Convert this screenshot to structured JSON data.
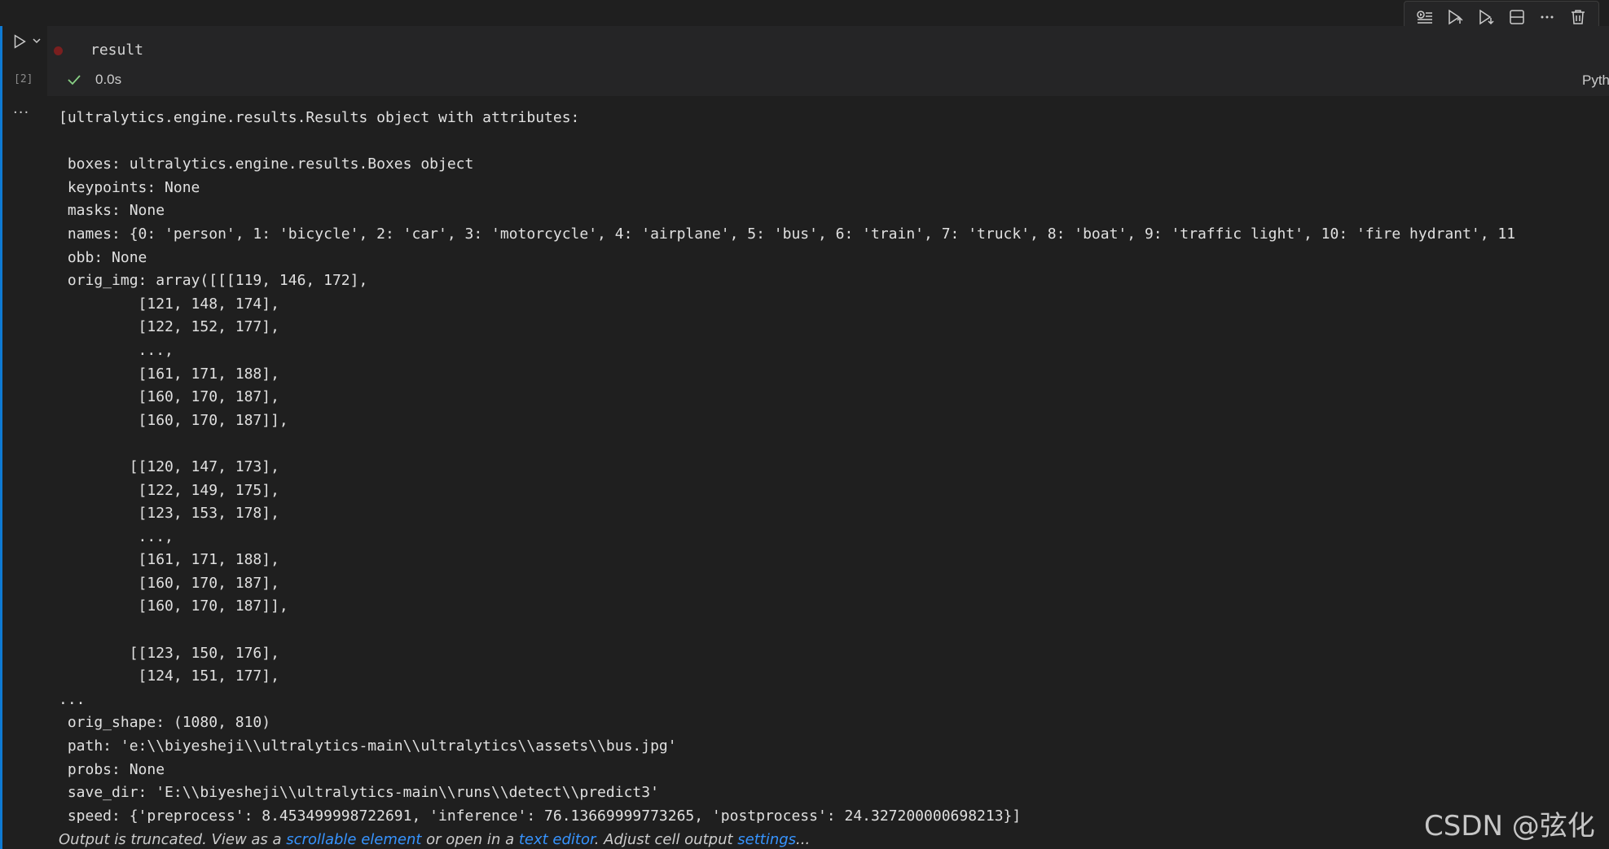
{
  "cell": {
    "code": "result",
    "exec_count": "[2]",
    "status_time": "0.0s",
    "language": "Python"
  },
  "toolbar": {
    "icons": [
      "run-by-line-icon",
      "execute-above-icon",
      "execute-below-icon",
      "split-cell-icon",
      "more-icon",
      "delete-icon"
    ]
  },
  "output": {
    "more_label": "···",
    "lines": [
      "[ultralytics.engine.results.Results object with attributes:",
      "",
      " boxes: ultralytics.engine.results.Boxes object",
      " keypoints: None",
      " masks: None",
      " names: {0: 'person', 1: 'bicycle', 2: 'car', 3: 'motorcycle', 4: 'airplane', 5: 'bus', 6: 'train', 7: 'truck', 8: 'boat', 9: 'traffic light', 10: 'fire hydrant', 11",
      " obb: None",
      " orig_img: array([[[119, 146, 172],",
      "         [121, 148, 174],",
      "         [122, 152, 177],",
      "         ...,",
      "         [161, 171, 188],",
      "         [160, 170, 187],",
      "         [160, 170, 187]],",
      "",
      "        [[120, 147, 173],",
      "         [122, 149, 175],",
      "         [123, 153, 178],",
      "         ...,",
      "         [161, 171, 188],",
      "         [160, 170, 187],",
      "         [160, 170, 187]],",
      "",
      "        [[123, 150, 176],",
      "         [124, 151, 177],",
      "...",
      " orig_shape: (1080, 810)",
      " path: 'e:\\\\biyesheji\\\\ultralytics-main\\\\ultralytics\\\\assets\\\\bus.jpg'",
      " probs: None",
      " save_dir: 'E:\\\\biyesheji\\\\ultralytics-main\\\\runs\\\\detect\\\\predict3'",
      " speed: {'preprocess': 8.453499998722691, 'inference': 76.13669999773265, 'postprocess': 24.327200000698213}]"
    ]
  },
  "truncation": {
    "prefix": "Output is truncated. View as a ",
    "link1": "scrollable element",
    "middle": " or open in a ",
    "link2": "text editor",
    "suffix": ". Adjust cell output ",
    "link3": "settings",
    "end": "..."
  },
  "watermark": "CSDN @弦化",
  "colors": {
    "accent": "#0e7ad3",
    "success": "#89d185",
    "link": "#3794ff",
    "breakpoint": "#7a1f1f"
  }
}
